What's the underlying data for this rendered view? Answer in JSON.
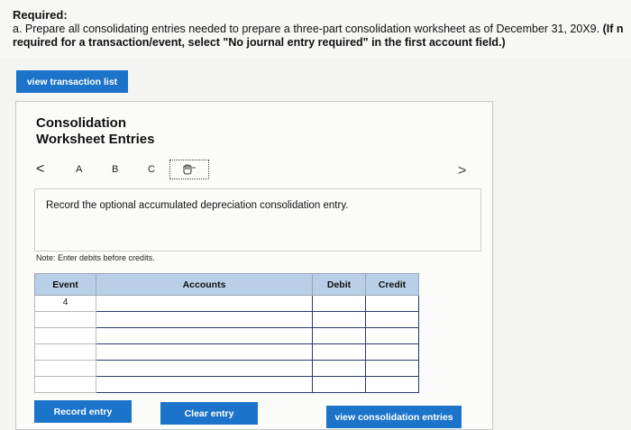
{
  "header": {
    "required_label": "Required:",
    "instruction_plain": "a. Prepare all consolidating entries needed to prepare a three-part consolidation worksheet as of December 31, 20X9. ",
    "instruction_bold_1": "(If n",
    "instruction_bold_2": "required for a transaction/event, select \"No journal entry required\" in the first account field.)"
  },
  "view_transaction_list": "view transaction list",
  "panel": {
    "title_line1": "Consolidation",
    "title_line2": "Worksheet Entries",
    "nav": {
      "prev": "<",
      "tabs": [
        "A",
        "B",
        "C"
      ],
      "next": ">",
      "current_icon": "hand-pointer-icon"
    },
    "prompt": "Record the optional accumulated depreciation consolidation entry.",
    "note": "Note: Enter debits before credits."
  },
  "table": {
    "headers": [
      "Event",
      "Accounts",
      "Debit",
      "Credit"
    ],
    "rows": [
      {
        "event": "4",
        "account": "",
        "debit": "",
        "credit": ""
      },
      {
        "event": "",
        "account": "",
        "debit": "",
        "credit": ""
      },
      {
        "event": "",
        "account": "",
        "debit": "",
        "credit": ""
      },
      {
        "event": "",
        "account": "",
        "debit": "",
        "credit": ""
      },
      {
        "event": "",
        "account": "",
        "debit": "",
        "credit": ""
      },
      {
        "event": "",
        "account": "",
        "debit": "",
        "credit": ""
      }
    ]
  },
  "buttons": {
    "record": "Record entry",
    "clear": "Clear entry",
    "view_consolidation": "view consolidation entries"
  },
  "colors": {
    "button_blue": "#1b74c9",
    "header_blue": "#b9cfe8"
  }
}
